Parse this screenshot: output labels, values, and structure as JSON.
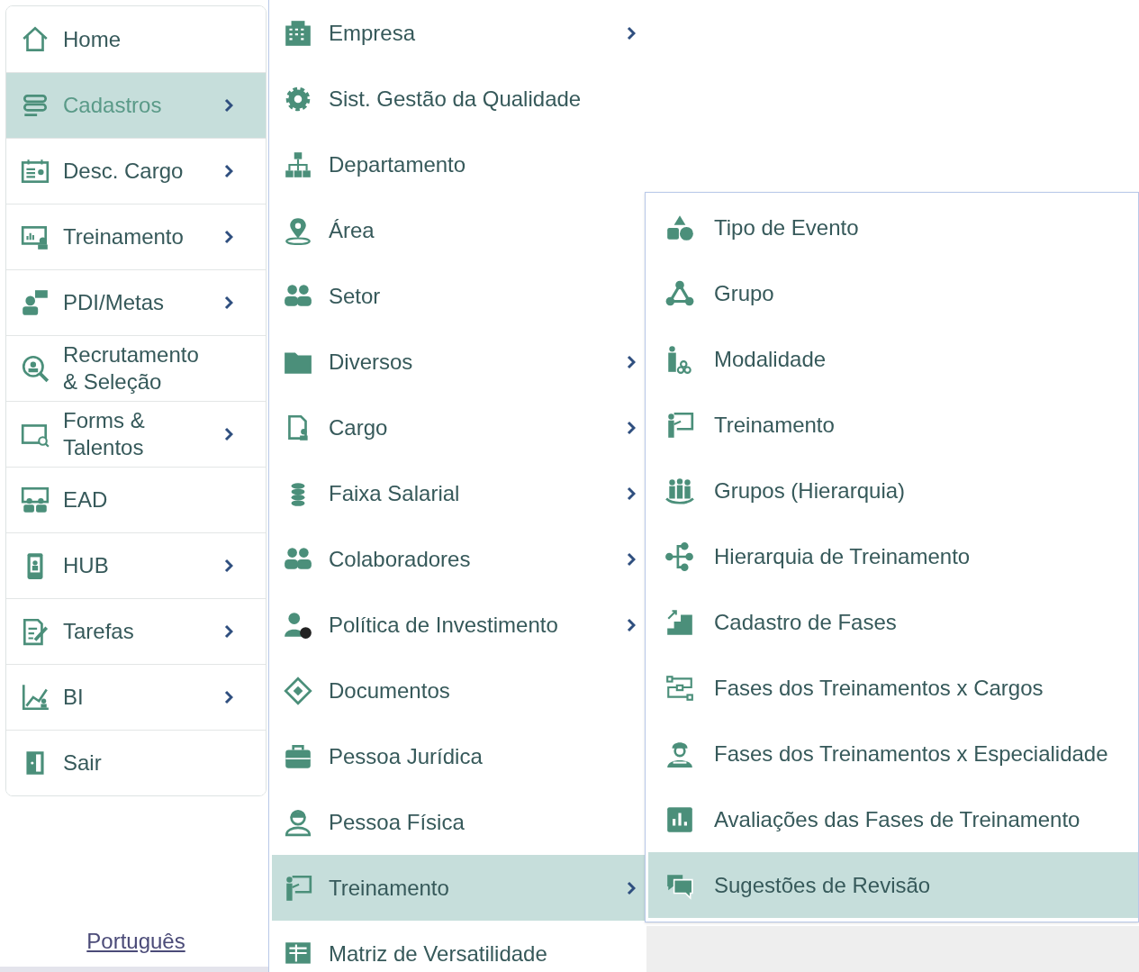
{
  "sidebar": {
    "items": [
      {
        "label": "Home",
        "selected": false,
        "submenu": false
      },
      {
        "label": "Cadastros",
        "selected": true,
        "submenu": true
      },
      {
        "label": "Desc. Cargo",
        "selected": false,
        "submenu": true
      },
      {
        "label": "Treinamento",
        "selected": false,
        "submenu": true
      },
      {
        "label": "PDI/Metas",
        "selected": false,
        "submenu": true
      },
      {
        "label": "Recrutamento & Seleção",
        "selected": false,
        "submenu": false
      },
      {
        "label": "Forms & Talentos",
        "selected": false,
        "submenu": true
      },
      {
        "label": "EAD",
        "selected": false,
        "submenu": false
      },
      {
        "label": "HUB",
        "selected": false,
        "submenu": true
      },
      {
        "label": "Tarefas",
        "selected": false,
        "submenu": true
      },
      {
        "label": "BI",
        "selected": false,
        "submenu": true
      },
      {
        "label": "Sair",
        "selected": false,
        "submenu": false
      }
    ],
    "language_link": "Português"
  },
  "submenu": {
    "items": [
      {
        "label": "Empresa",
        "selected": false,
        "submenu": true
      },
      {
        "label": "Sist. Gestão da Qualidade",
        "selected": false,
        "submenu": false
      },
      {
        "label": "Departamento",
        "selected": false,
        "submenu": false
      },
      {
        "label": "Área",
        "selected": false,
        "submenu": false
      },
      {
        "label": "Setor",
        "selected": false,
        "submenu": false
      },
      {
        "label": "Diversos",
        "selected": false,
        "submenu": true
      },
      {
        "label": "Cargo",
        "selected": false,
        "submenu": true
      },
      {
        "label": "Faixa Salarial",
        "selected": false,
        "submenu": true
      },
      {
        "label": "Colaboradores",
        "selected": false,
        "submenu": true
      },
      {
        "label": "Política de Investimento",
        "selected": false,
        "submenu": true
      },
      {
        "label": "Documentos",
        "selected": false,
        "submenu": false
      },
      {
        "label": "Pessoa Jurídica",
        "selected": false,
        "submenu": false
      },
      {
        "label": "Pessoa Física",
        "selected": false,
        "submenu": false
      },
      {
        "label": "Treinamento",
        "selected": true,
        "submenu": true
      },
      {
        "label": "Matriz de Versatilidade",
        "selected": false,
        "submenu": false
      }
    ]
  },
  "nested_submenu": {
    "items": [
      {
        "label": "Tipo de Evento",
        "selected": false
      },
      {
        "label": "Grupo",
        "selected": false
      },
      {
        "label": "Modalidade",
        "selected": false
      },
      {
        "label": "Treinamento",
        "selected": false
      },
      {
        "label": "Grupos (Hierarquia)",
        "selected": false
      },
      {
        "label": "Hierarquia de Treinamento",
        "selected": false
      },
      {
        "label": "Cadastro de Fases",
        "selected": false
      },
      {
        "label": "Fases dos Treinamentos x Cargos",
        "selected": false
      },
      {
        "label": "Fases dos Treinamentos x Especialidade",
        "selected": false
      },
      {
        "label": "Avaliações das Fases de Treinamento",
        "selected": false
      },
      {
        "label": "Sugestões de Revisão",
        "selected": true
      }
    ]
  }
}
